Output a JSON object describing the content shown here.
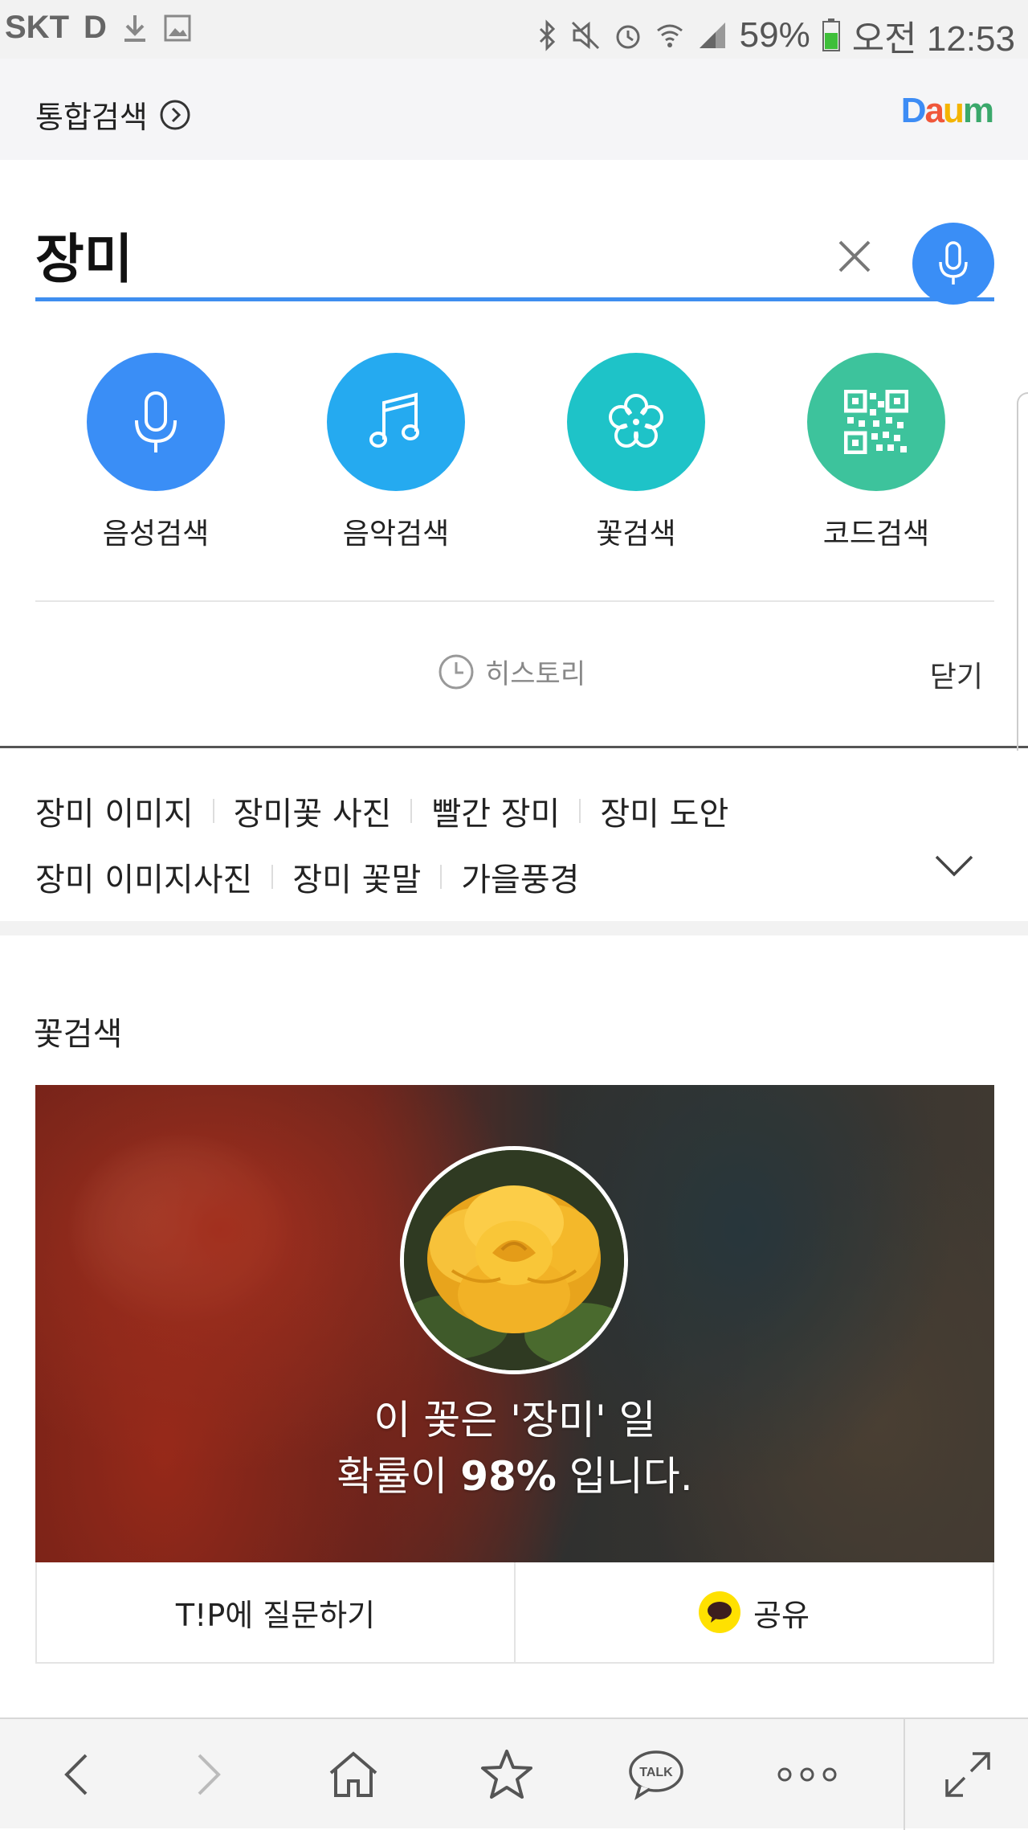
{
  "status_bar": {
    "carrier": "SKT",
    "battery_percent": "59%",
    "time": "오전 12:53"
  },
  "header": {
    "title": "통합검색",
    "logo_text": "Daum",
    "logo_colors": [
      "#3d8cf5",
      "#f0563a",
      "#f4b400",
      "#3aa86b",
      "#f0563a"
    ]
  },
  "search": {
    "query": "장미",
    "accent_color": "#3e8ef0"
  },
  "quick_tools": [
    {
      "label": "음성검색",
      "icon": "microphone-icon",
      "color": "#3a8ef6"
    },
    {
      "label": "음악검색",
      "icon": "music-note-icon",
      "color": "#25aaf0"
    },
    {
      "label": "꽃검색",
      "icon": "flower-icon",
      "color": "#1ec3c8"
    },
    {
      "label": "코드검색",
      "icon": "qr-code-icon",
      "color": "#3dc39c"
    }
  ],
  "history": {
    "label": "히스토리",
    "close_label": "닫기"
  },
  "related": {
    "row1": [
      "장미 이미지",
      "장미꽃 사진",
      "빨간 장미",
      "장미 도안"
    ],
    "row2": [
      "장미 이미지사진",
      "장미 꽃말",
      "가을풍경"
    ]
  },
  "flower_search": {
    "section_title": "꽃검색",
    "result_line1": "이 꽃은 '장미' 일",
    "result_prefix": "확률이 ",
    "probability": "98%",
    "result_suffix": " 입니다.",
    "ask_label": "T!P에 질문하기",
    "share_label": "공유"
  },
  "bottom_nav": [
    "back-icon",
    "forward-icon",
    "home-icon",
    "star-icon",
    "talk-icon",
    "more-icon",
    "expand-icon"
  ],
  "bottom_talk_text": "TALK"
}
